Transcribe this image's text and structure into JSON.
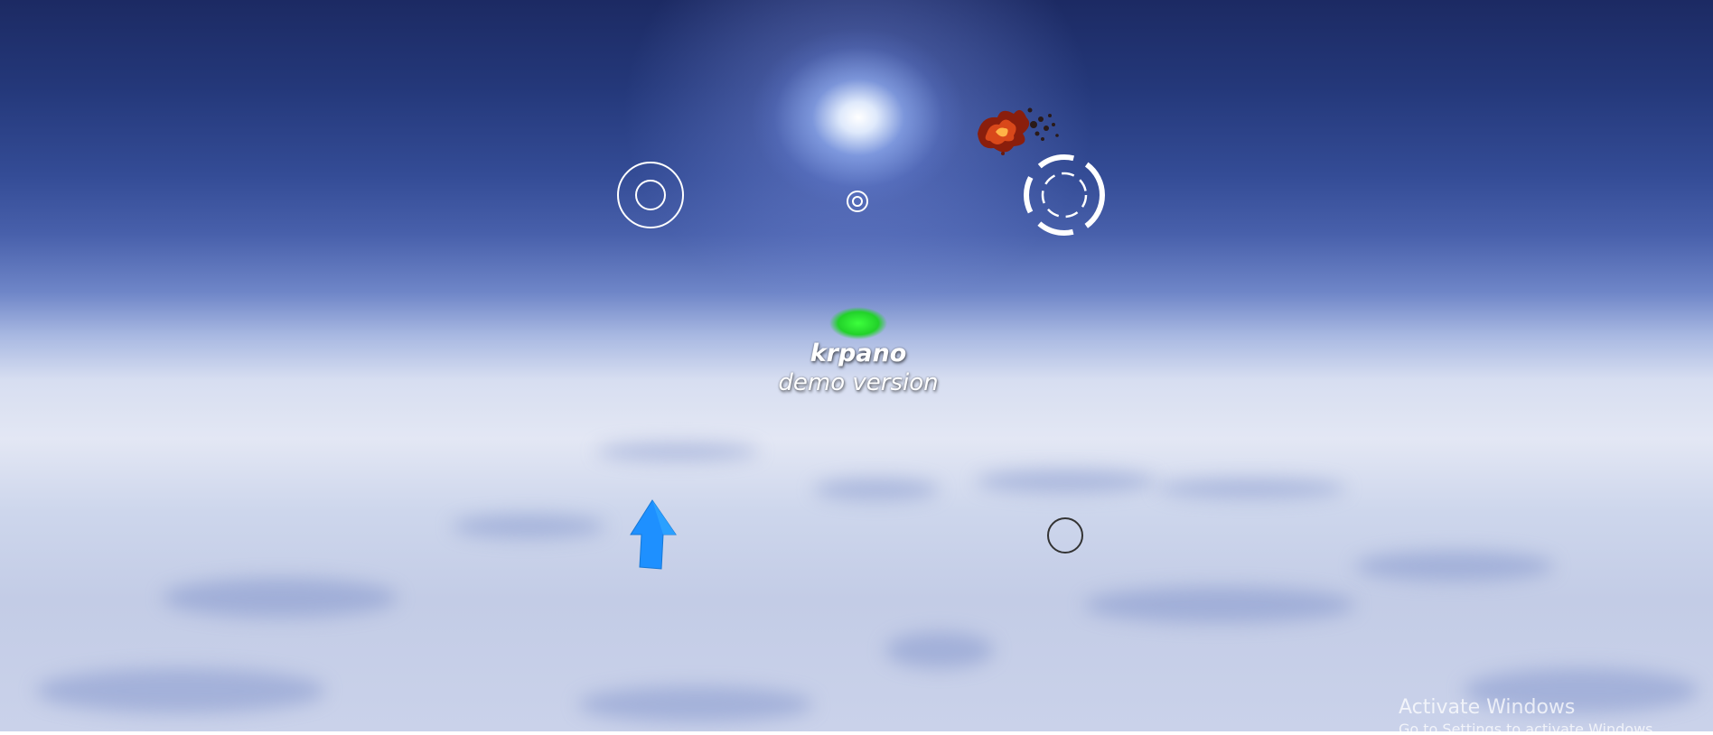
{
  "viewer": {
    "type": "krpano panorama viewer",
    "sky_color_top": "#1c2a63",
    "horizon_color": "#e3e7f4",
    "cloud_color": "#c3cce6"
  },
  "logo": {
    "name": "krpano",
    "subtitle": "demo version"
  },
  "hotspots": [
    {
      "icon": "ring-target-icon",
      "color": "#ffffff"
    },
    {
      "icon": "small-ring-target-icon",
      "color": "#ffffff"
    },
    {
      "icon": "dashed-ring-target-icon",
      "color": "#ffffff"
    },
    {
      "icon": "fire-explosion-icon",
      "color": "#c8461a"
    },
    {
      "icon": "green-hotspot-icon",
      "color": "#22d12a"
    },
    {
      "icon": "blue-arrow-up-icon",
      "color": "#1e90ff"
    },
    {
      "icon": "dark-ring-icon",
      "color": "#333333"
    }
  ],
  "os_watermark": {
    "title": "Activate Windows",
    "subtitle": "Go to Settings to activate Windows."
  }
}
